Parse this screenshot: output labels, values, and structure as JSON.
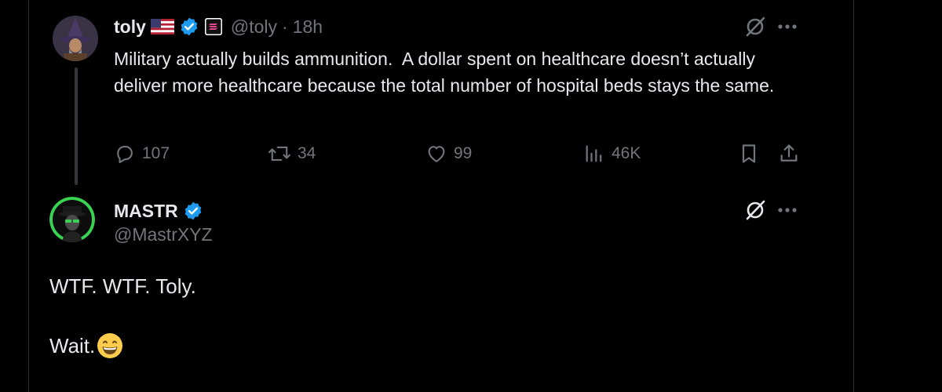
{
  "original_tweet": {
    "display_name": "toly",
    "flag_icon": "us-flag-icon",
    "affiliation_icon": "solana-badge-icon",
    "handle": "@toly",
    "separator": "·",
    "time": "18h",
    "text": "Military actually builds ammunition.  A dollar spent on healthcare doesn’t actually deliver more healthcare because the total number of hospital beds stays the same.",
    "actions": {
      "replies": "107",
      "reposts": "34",
      "likes": "99",
      "views": "46K"
    }
  },
  "reply_tweet": {
    "display_name": "MASTR",
    "handle": "@MastrXYZ",
    "line1": "WTF. WTF. Toly.",
    "line2": "Wait.",
    "emoji_icon": "grinning-face-emoji"
  },
  "colors": {
    "background": "#000000",
    "text": "#e7e9ea",
    "muted": "#71767b",
    "verified": "#1d9bf0",
    "divider": "#2f3336",
    "mastr_ring": "#39d353"
  }
}
